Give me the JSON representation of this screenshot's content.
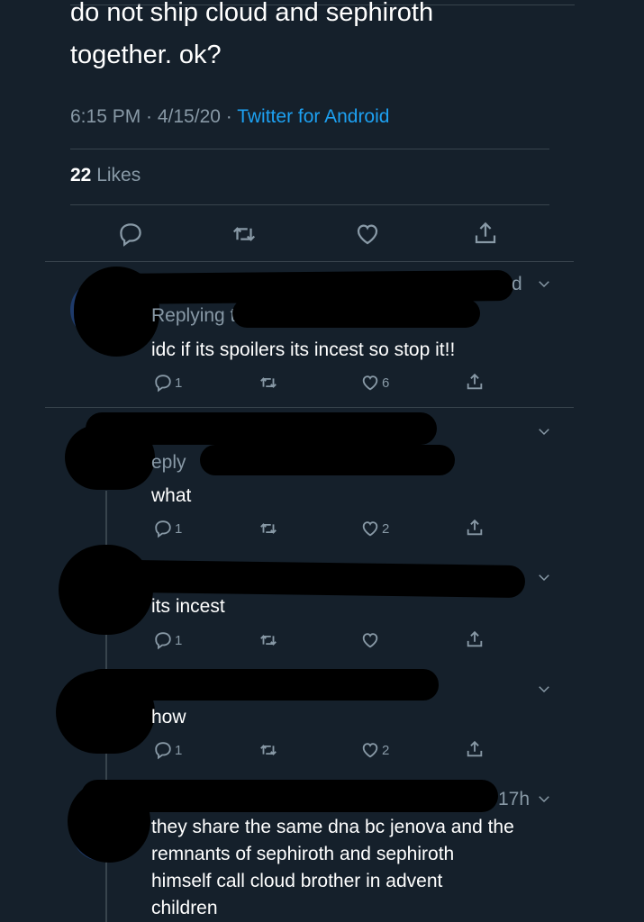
{
  "tweet": {
    "line1": "do not ship cloud and sephiroth",
    "line2": "together.  ok?",
    "time": "6:15 PM · 4/15/20 · ",
    "source": "Twitter for Android",
    "likes_count": "22",
    "likes_label": " Likes"
  },
  "replies": [
    {
      "replying": "Replying t",
      "time_frag": "d",
      "text": "idc if its spoilers its incest so stop it!!",
      "reply_count": "1",
      "like_count": "6"
    },
    {
      "replying_frag": "eply",
      "text": "what",
      "reply_count": "1",
      "like_count": "2"
    },
    {
      "text": "its incest",
      "reply_count": "1",
      "like_count": ""
    },
    {
      "text": "how",
      "reply_count": "1",
      "like_count": "2"
    },
    {
      "time_frag": "17h",
      "text_lines": [
        "they share the same dna bc jenova and the",
        "remnants of sephiroth and sephiroth",
        "himself call cloud brother in advent",
        "children"
      ]
    }
  ],
  "icons": {
    "reply": "reply-icon",
    "retweet": "retweet-icon",
    "like": "heart-icon",
    "share": "share-icon",
    "more": "chevron-down-icon"
  }
}
